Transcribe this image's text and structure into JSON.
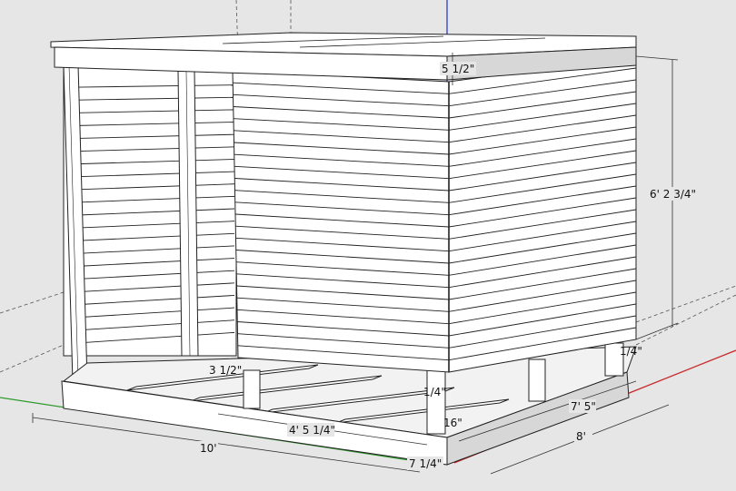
{
  "scene": {
    "background": "#e6e6e6",
    "wood_color": "#ffffff",
    "shade_color": "#d7d7d7",
    "edge_color": "#222222",
    "axis_green": "#2e9b2e",
    "axis_red": "#c82a2a",
    "axis_blue": "#2a3fd0",
    "dimensions": {
      "top_thickness": "5 1/2\"",
      "wall_height": "6' 2 3/4\"",
      "floor_joist_side": "3 1/2\"",
      "front_span": "4' 5 1/4\"",
      "length": "10'",
      "base_height": "7 1/4\"",
      "corner_gap": "1/4\"",
      "side_inner": "7' 5\"",
      "side_width": "8'",
      "joist_spacing": "16\"",
      "right_small": "1/4\""
    }
  }
}
